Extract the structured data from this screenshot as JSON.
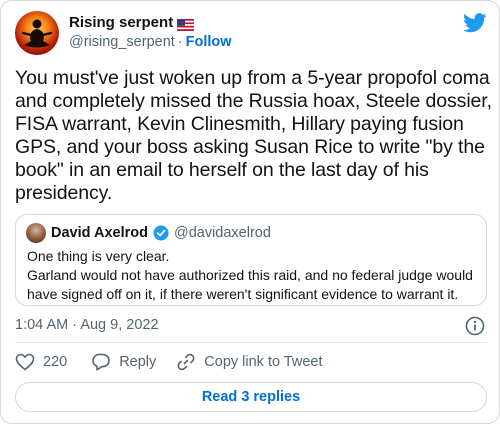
{
  "author": {
    "name": "Rising serpent",
    "handle": "@rising_serpent",
    "separator": "·",
    "follow_label": "Follow",
    "flag_icon": "us-flag-icon"
  },
  "tweet": {
    "text": "You must've just woken up from a 5-year propofol coma and completely missed the Russia hoax, Steele dossier, FISA warrant, Kevin Clinesmith, Hillary paying fusion GPS, and your boss asking Susan Rice to write \"by the book\" in an email to herself on the last day of his presidency."
  },
  "quoted_tweet": {
    "name": "David Axelrod",
    "handle": "@davidaxelrod",
    "verified": true,
    "line1": "One thing is very clear.",
    "line2": "Garland would not have authorized this raid, and no federal judge would have signed off on it, if there weren't significant evidence to warrant it."
  },
  "meta": {
    "time": "1:04 AM",
    "separator": "·",
    "date": "Aug 9, 2022"
  },
  "actions": {
    "like_count": "220",
    "reply_label": "Reply",
    "copy_label": "Copy link to Tweet"
  },
  "read_replies_label": "Read 3 replies",
  "colors": {
    "brand_blue": "#1d9bf0",
    "link_blue": "#006fd6",
    "secondary_text": "#536471",
    "border": "#cfd9de"
  }
}
